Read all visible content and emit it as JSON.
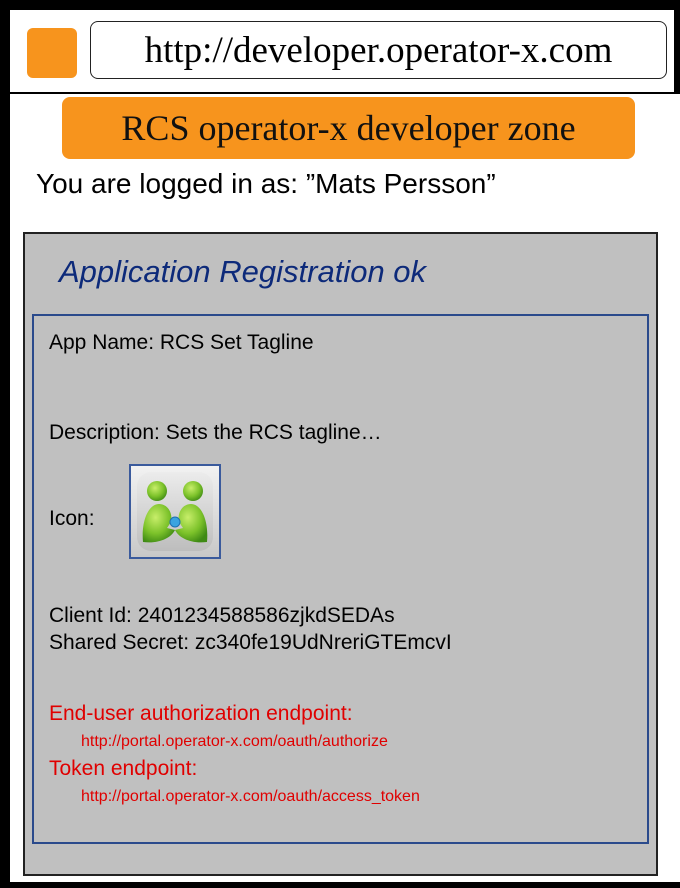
{
  "browser": {
    "url": "http://developer.operator-x.com"
  },
  "header": {
    "zone_title": "RCS operator-x developer zone",
    "logged_in_text": "You are logged in as: ”Mats Persson”"
  },
  "registration": {
    "title": "Application Registration ok",
    "app_name": "App Name: RCS Set Tagline",
    "description": "Description: Sets the RCS tagline…",
    "icon_label": "Icon:",
    "icon_name": "rcs-app-people-icon",
    "client_id": "Client Id: 2401234588586zjkdSEDAs",
    "shared_secret": "Shared Secret: zc340fe19UdNreriGTEmcvI",
    "auth_endpoint_label": "End-user authorization endpoint:",
    "auth_endpoint_url": "http://portal.operator-x.com/oauth/authorize",
    "token_endpoint_label": "Token endpoint:",
    "token_endpoint_url": "http://portal.operator-x.com/oauth/access_token"
  },
  "colors": {
    "accent_orange": "#f7941d",
    "title_blue": "#0d2a7a",
    "endpoint_red": "#e00000",
    "panel_gray": "#c0c0c0"
  }
}
